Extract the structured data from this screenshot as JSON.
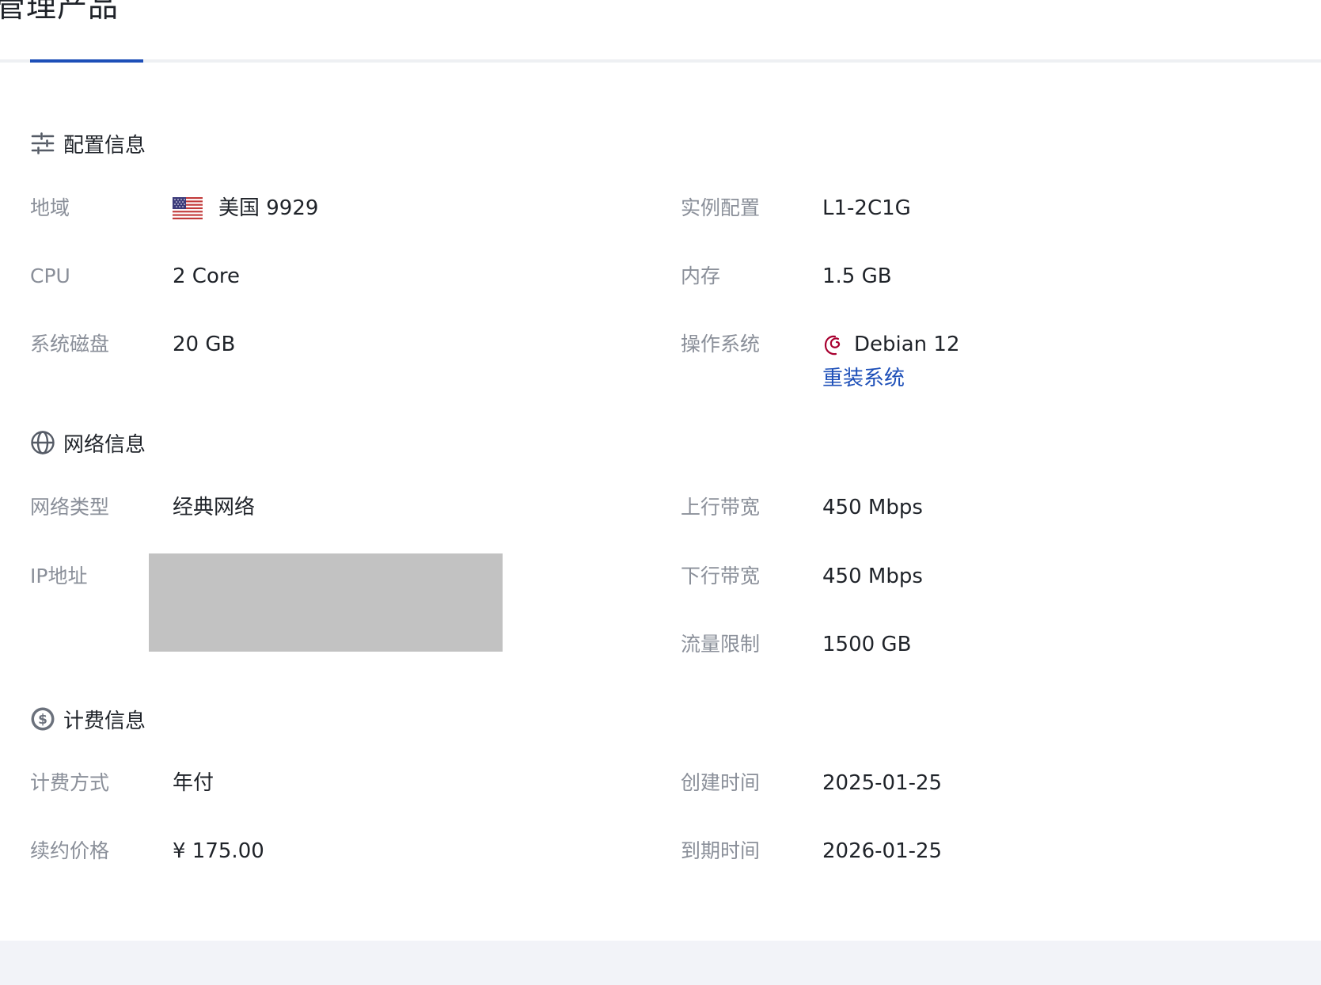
{
  "header": {
    "title": "管理产品"
  },
  "sections": {
    "config": {
      "title": "配置信息",
      "icon": "sliders-icon",
      "region_label": "地域",
      "region_value": "美国 9929",
      "region_flag": "us-flag-icon",
      "instance_label": "实例配置",
      "instance_value": "L1-2C1G",
      "cpu_label": "CPU",
      "cpu_value": "2 Core",
      "memory_label": "内存",
      "memory_value": "1.5 GB",
      "disk_label": "系统磁盘",
      "disk_value": "20 GB",
      "os_label": "操作系统",
      "os_value": "Debian 12",
      "os_icon": "debian-logo-icon",
      "reinstall_label": "重装系统"
    },
    "network": {
      "title": "网络信息",
      "icon": "globe-icon",
      "type_label": "网络类型",
      "type_value": "经典网络",
      "upload_label": "上行带宽",
      "upload_value": "450 Mbps",
      "ip_label": "IP地址",
      "download_label": "下行带宽",
      "download_value": "450 Mbps",
      "traffic_label": "流量限制",
      "traffic_value": "1500 GB"
    },
    "billing": {
      "title": "计费信息",
      "icon": "dollar-circle-icon",
      "method_label": "计费方式",
      "method_value": "年付",
      "created_label": "创建时间",
      "created_value": "2025-01-25",
      "renew_label": "续约价格",
      "renew_value": "¥ 175.00",
      "expire_label": "到期时间",
      "expire_value": "2026-01-25"
    }
  },
  "colors": {
    "accent": "#1d4fb8",
    "label": "#8a8f99",
    "text": "#1f2329",
    "debian": "#a80030",
    "redacted": "#c2c2c2"
  }
}
